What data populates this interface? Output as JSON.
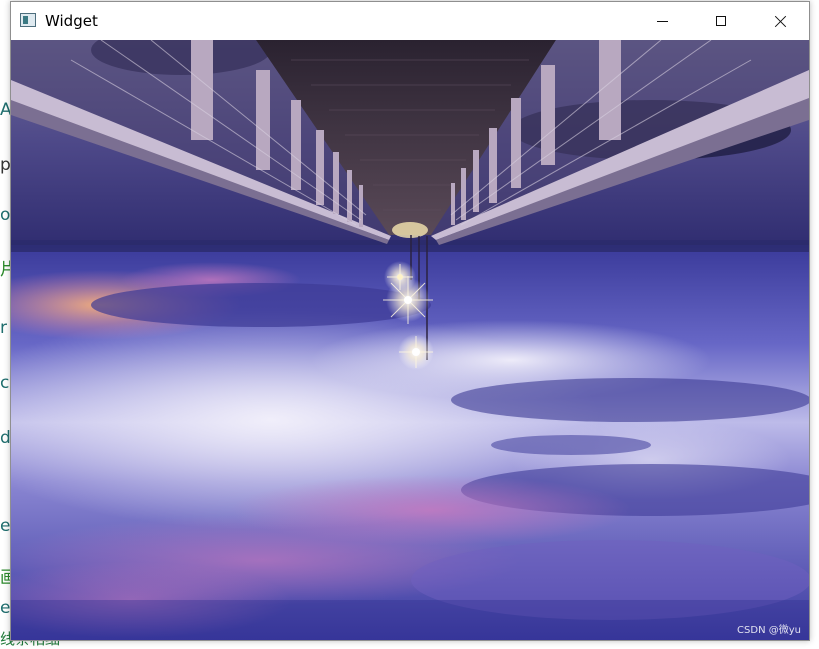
{
  "background_editor": {
    "bottom_text": "线条相细"
  },
  "window": {
    "title": "Widget",
    "icon": "qt-window-icon",
    "controls": {
      "minimize": "minimize-icon",
      "maximize": "maximize-icon",
      "close": "close-icon"
    }
  },
  "image": {
    "watermark": "CSDN @微yu",
    "colors": {
      "sky_top": "#1b1a55",
      "sky_mid": "#4a4aa8",
      "cloud_light": "#e9e6f7",
      "cloud_pink": "#c77cc0",
      "sunset": "#f2a36b",
      "bridge_deck": "#3a2f3c",
      "railing": "#a79ab5"
    }
  }
}
